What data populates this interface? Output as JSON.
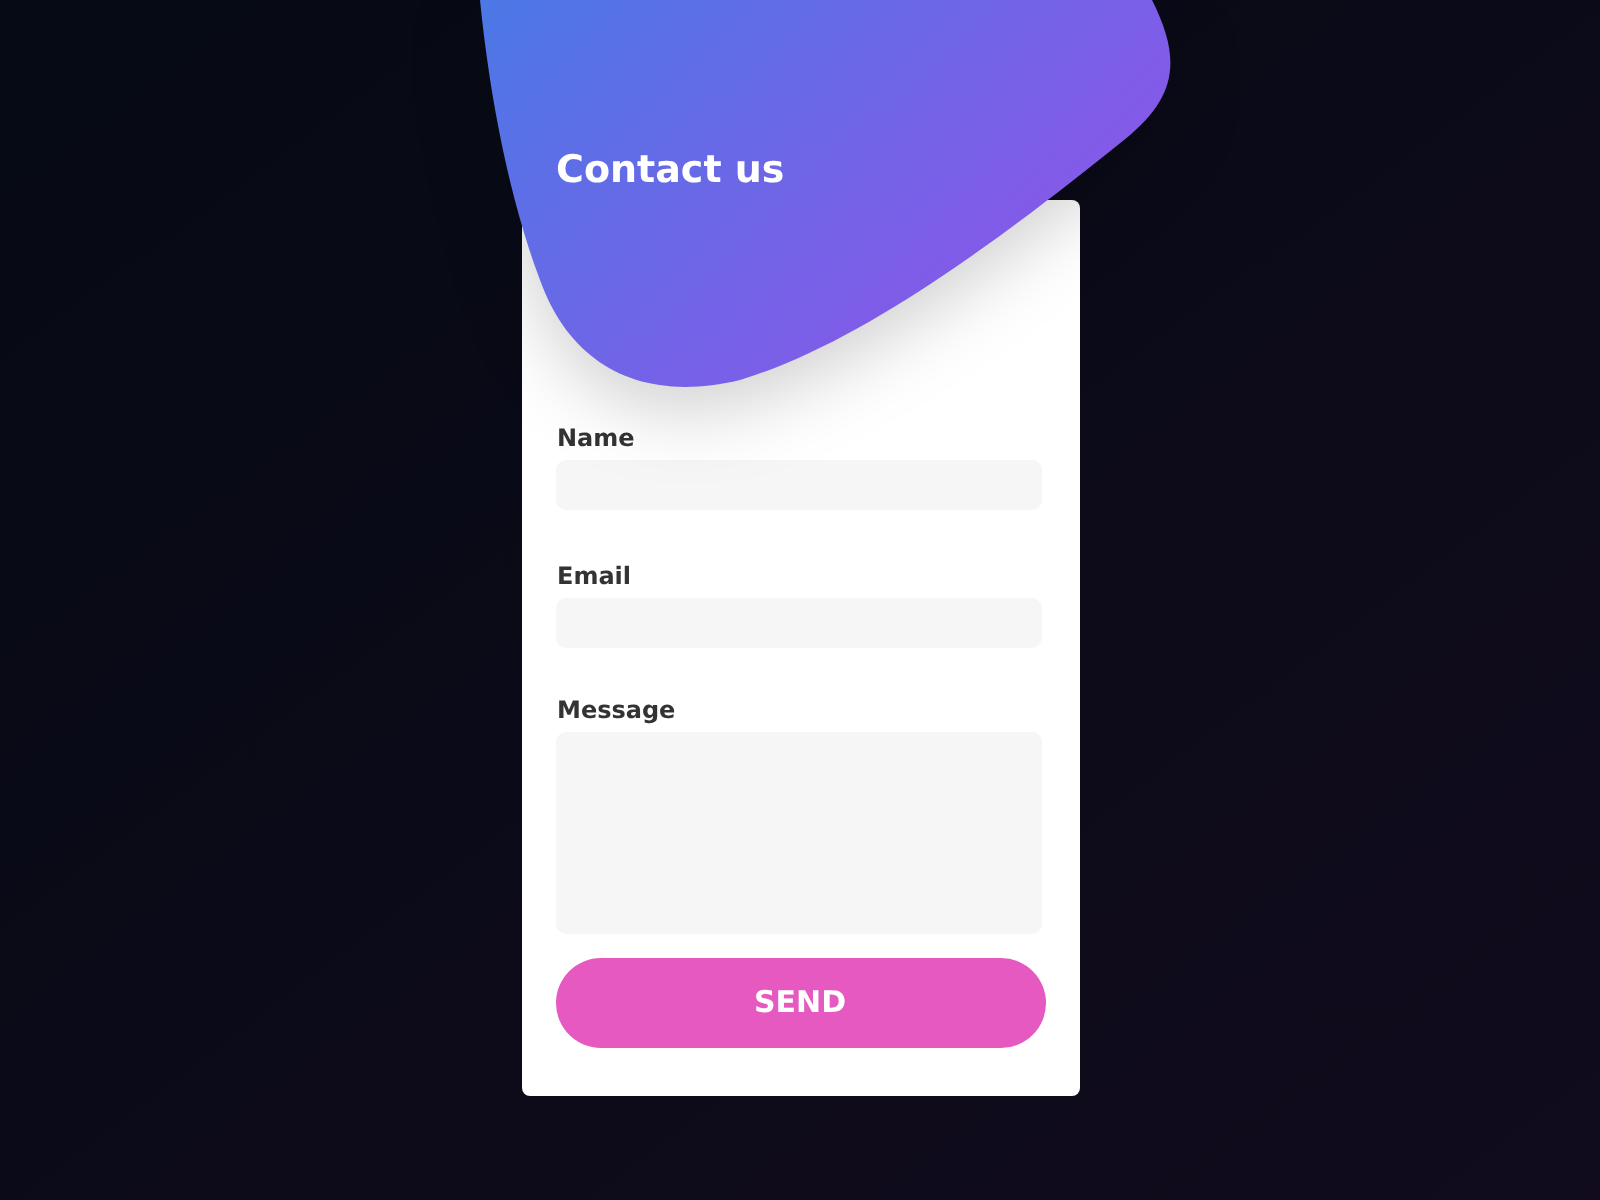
{
  "title": "Contact us",
  "fields": [
    {
      "label": "Name",
      "kind": "input"
    },
    {
      "label": "Email",
      "kind": "input"
    },
    {
      "label": "Message",
      "kind": "textarea"
    }
  ],
  "button": "SEND"
}
